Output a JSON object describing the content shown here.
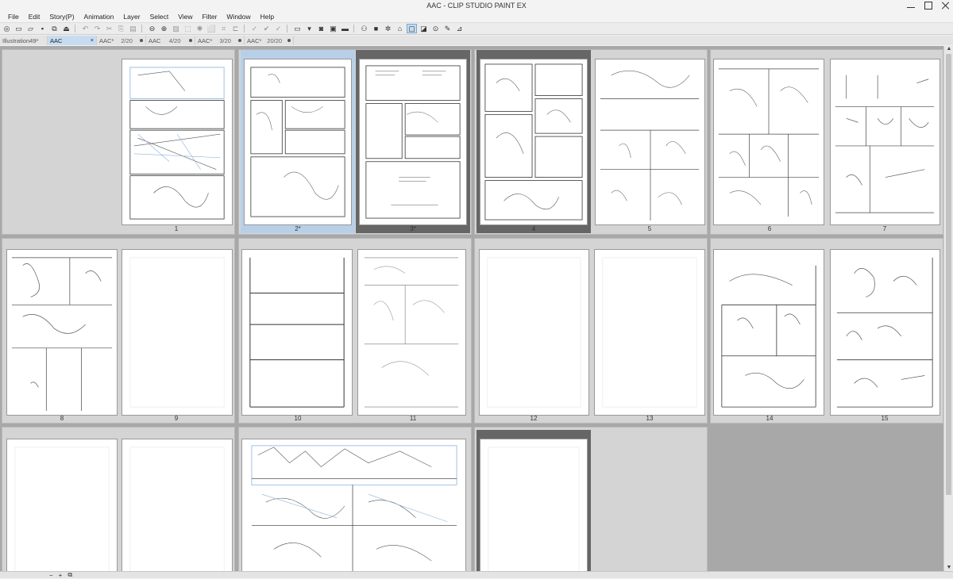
{
  "app": {
    "title": "AAC - CLIP STUDIO PAINT EX"
  },
  "menu": [
    "File",
    "Edit",
    "Story(P)",
    "Animation",
    "Layer",
    "Select",
    "View",
    "Filter",
    "Window",
    "Help"
  ],
  "toolbar_icons": [
    "new-icon",
    "open-icon",
    "save-icon",
    "undo-icon",
    "redo-icon",
    "cut-icon",
    "copy-icon",
    "paste-icon",
    "zoom-out-icon",
    "zoom-in-icon",
    "brush-icon",
    "transform-icon",
    "pen-icon",
    "color-swatch-icon"
  ],
  "tabs": [
    {
      "label": "Illustration49*",
      "count": "",
      "active": false
    },
    {
      "label": "AAC",
      "count": "",
      "active": true,
      "close": "×"
    },
    {
      "label": "AAC*",
      "count": "2/20",
      "active": false
    },
    {
      "label": "AAC",
      "count": "4/20",
      "active": false
    },
    {
      "label": "AAC*",
      "count": "3/20",
      "active": false
    },
    {
      "label": "AAC*",
      "count": "20/20",
      "active": false
    }
  ],
  "pages": [
    {
      "label": "1"
    },
    {
      "label": "2*"
    },
    {
      "label": "3*"
    },
    {
      "label": "4"
    },
    {
      "label": "5"
    },
    {
      "label": "6"
    },
    {
      "label": "7"
    },
    {
      "label": "8"
    },
    {
      "label": "9"
    },
    {
      "label": "10"
    },
    {
      "label": "11"
    },
    {
      "label": "12"
    },
    {
      "label": "13"
    },
    {
      "label": "14"
    },
    {
      "label": "15"
    }
  ],
  "bottom": {
    "minus": "−",
    "plus": "+"
  },
  "colors": {
    "selected_page": "#b7d0e8",
    "workspace": "#a8a8a8",
    "group": "#d4d4d4"
  }
}
